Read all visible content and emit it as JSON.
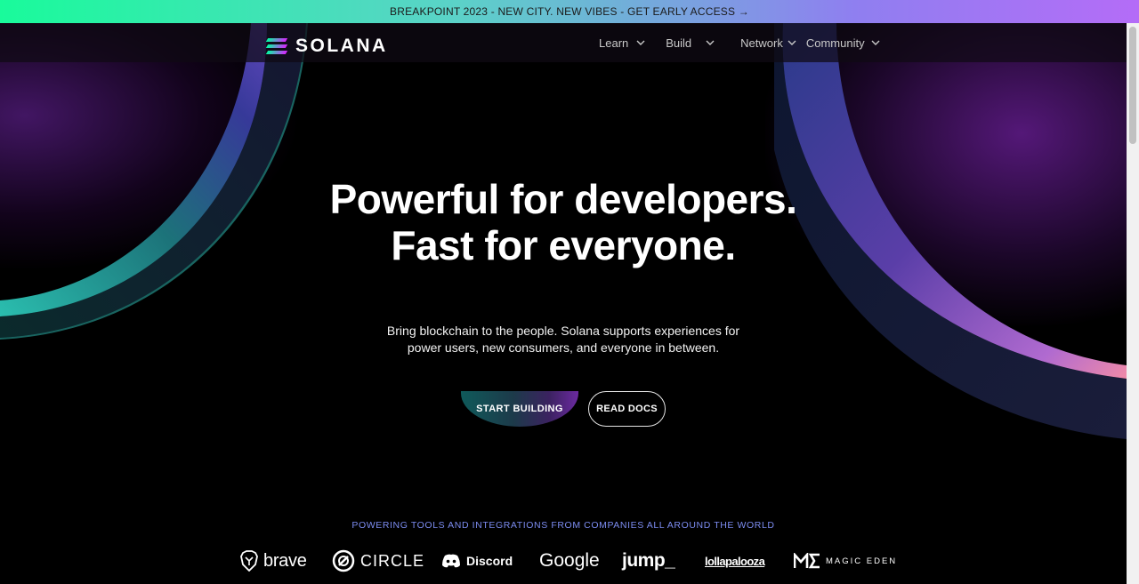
{
  "banner": {
    "text": "BREAKPOINT 2023 - NEW CITY. NEW VIBES - GET EARLY ACCESS →"
  },
  "header": {
    "logo_text": "SOLANA",
    "nav": [
      {
        "label": "Learn"
      },
      {
        "label": "Build"
      },
      {
        "label": "Network"
      },
      {
        "label": "Community"
      }
    ]
  },
  "hero": {
    "title_line1": "Powerful for developers.",
    "title_line2": "Fast for everyone.",
    "subtitle_line1": "Bring blockchain to the people. Solana supports experiences for",
    "subtitle_line2": "power users, new consumers, and everyone in between.",
    "primary_button": "START BUILDING",
    "secondary_button": "READ DOCS"
  },
  "partners": {
    "heading": "POWERING TOOLS AND INTEGRATIONS FROM COMPANIES ALL AROUND THE WORLD",
    "logos": [
      {
        "name": "brave",
        "icon": "lion-shield-icon"
      },
      {
        "name": "CIRCLE",
        "icon": "circle-logo-icon"
      },
      {
        "name": "Discord",
        "icon": "discord-icon"
      },
      {
        "name": "Google"
      },
      {
        "name": "jump_"
      },
      {
        "name": "lollapalooza"
      },
      {
        "name": "MAGIC EDEN",
        "icon": "magic-eden-icon"
      }
    ]
  },
  "colors": {
    "banner_gradient_start": "#19fb9b",
    "banner_gradient_end": "#b46cf7",
    "partners_heading": "#7c8cf0",
    "background": "#000000"
  }
}
